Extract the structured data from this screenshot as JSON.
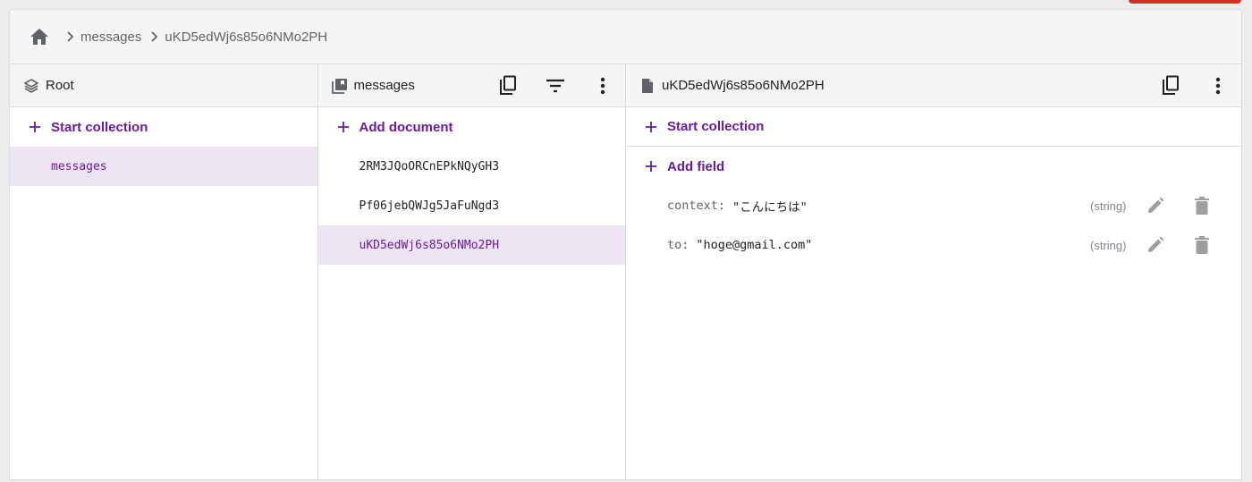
{
  "breadcrumb": {
    "home_icon": "home-icon",
    "items": [
      "messages",
      "uKD5edWj6s85o6NMo2PH"
    ]
  },
  "root_panel": {
    "title": "Root",
    "action": "Start collection",
    "items": [
      "messages"
    ],
    "selected_index": 0
  },
  "collection_panel": {
    "title": "messages",
    "action": "Add document",
    "items": [
      "2RM3JQoORCnEPkNQyGH3",
      "Pf06jebQWJg5JaFuNgd3",
      "uKD5edWj6s85o6NMo2PH"
    ],
    "selected_index": 2
  },
  "document_panel": {
    "title": "uKD5edWj6s85o6NMo2PH",
    "action_collection": "Start collection",
    "action_field": "Add field",
    "fields": [
      {
        "key": "context:",
        "value": "\"こんにちは\"",
        "type": "(string)"
      },
      {
        "key": "to:",
        "value": "\"hoge@gmail.com\"",
        "type": "(string)"
      }
    ]
  },
  "colors": {
    "accent": "#6a1b9a",
    "selected_bg": "#ede4f3",
    "header_bg": "#f5f5f5",
    "alert": "#d93025"
  }
}
